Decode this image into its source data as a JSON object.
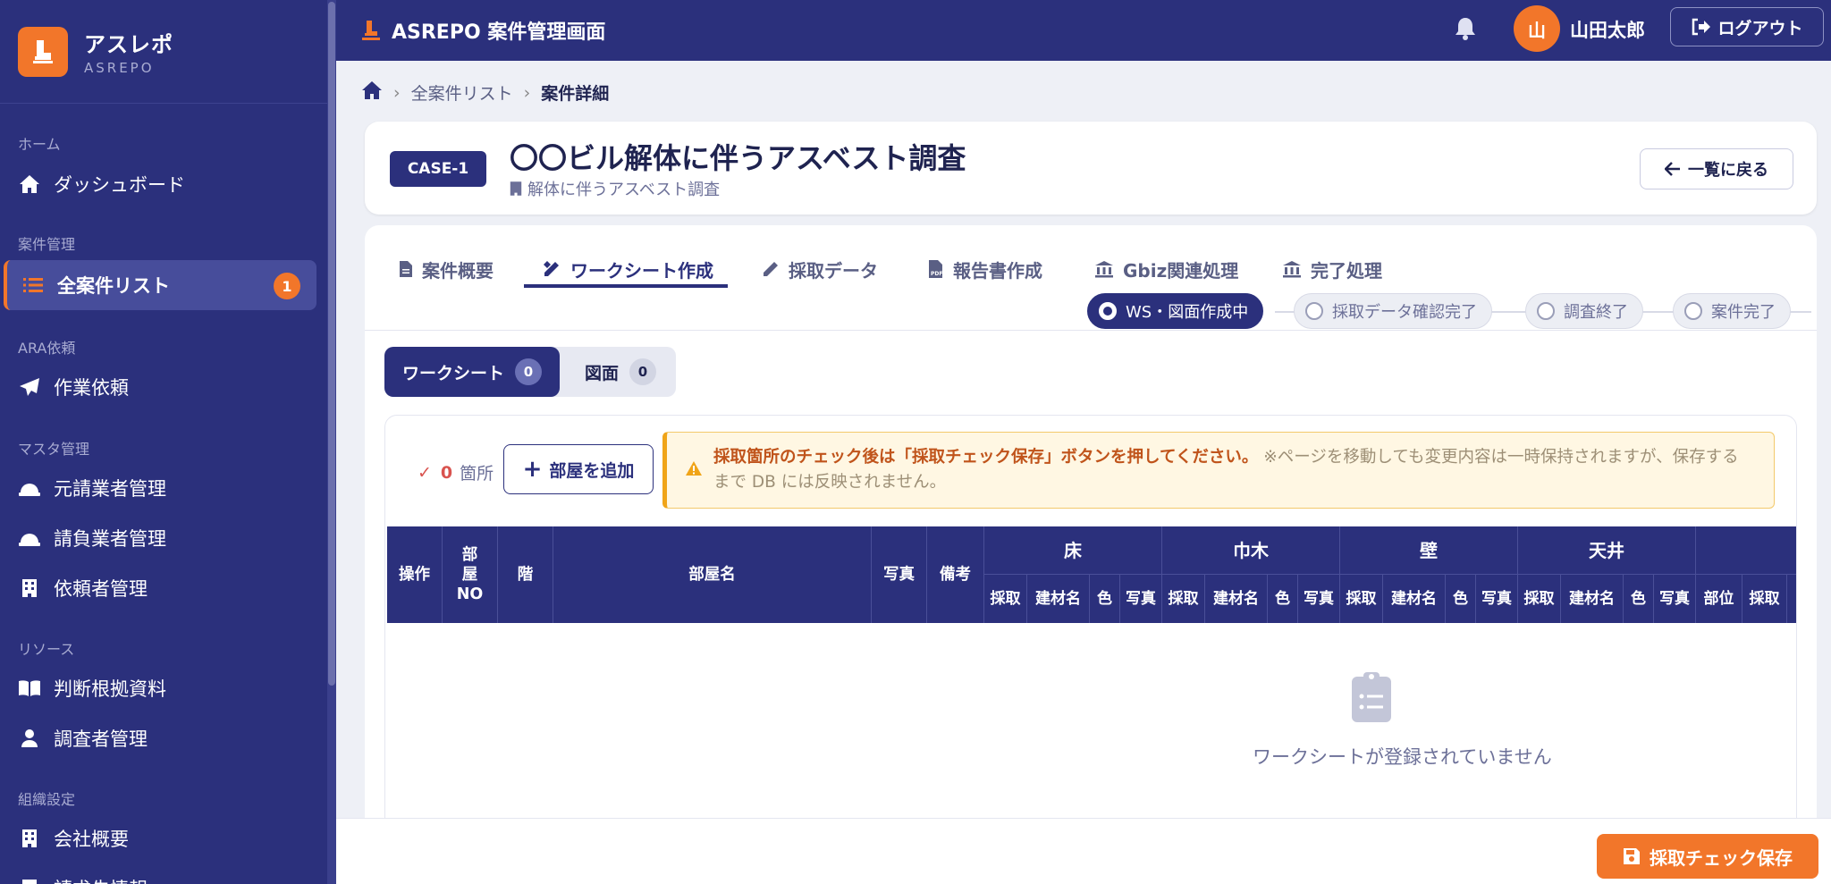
{
  "brand": {
    "name": "アスレポ",
    "sub": "ASREPO"
  },
  "sidebar": {
    "sections": [
      {
        "label": "ホーム",
        "items": [
          {
            "label": "ダッシュボード",
            "icon": "home-icon"
          }
        ]
      },
      {
        "label": "案件管理",
        "items": [
          {
            "label": "全案件リスト",
            "icon": "list-icon",
            "badge": "1",
            "active": true
          }
        ]
      },
      {
        "label": "ARA依頼",
        "items": [
          {
            "label": "作業依頼",
            "icon": "paper-plane-icon"
          }
        ]
      },
      {
        "label": "マスタ管理",
        "items": [
          {
            "label": "元請業者管理",
            "icon": "hard-hat-icon"
          },
          {
            "label": "請負業者管理",
            "icon": "hard-hat-icon"
          },
          {
            "label": "依頼者管理",
            "icon": "building-icon"
          }
        ]
      },
      {
        "label": "リソース",
        "items": [
          {
            "label": "判断根拠資料",
            "icon": "book-icon"
          },
          {
            "label": "調査者管理",
            "icon": "user-tie-icon"
          }
        ]
      },
      {
        "label": "組織設定",
        "items": [
          {
            "label": "会社概要",
            "icon": "building-icon"
          },
          {
            "label": "請求先情報",
            "icon": "building-icon"
          }
        ]
      }
    ]
  },
  "header": {
    "title": "ASREPO 案件管理画面",
    "user_initial": "山",
    "user_name": "山田太郎",
    "logout_label": "ログアウト"
  },
  "breadcrumb": {
    "level1": "全案件リスト",
    "current": "案件詳細"
  },
  "case": {
    "id": "CASE-1",
    "title": "〇〇ビル解体に伴うアスベスト調査",
    "subtitle": "解体に伴うアスベスト調査",
    "back_label": "一覧に戻る"
  },
  "tabs": [
    "案件概要",
    "ワークシート作成",
    "採取データ",
    "報告書作成",
    "Gbiz関連処理",
    "完了処理"
  ],
  "active_tab": "ワークシート作成",
  "statuses": [
    "WS・図面作成中",
    "採取データ確認完了",
    "調査終了",
    "案件完了"
  ],
  "active_status": "WS・図面作成中",
  "segments": {
    "worksheet_label": "ワークシート",
    "worksheet_count": "0",
    "drawing_label": "図面",
    "drawing_count": "0"
  },
  "toolbar": {
    "check": "✓",
    "count": "0",
    "count_unit": "箇所",
    "add_room_label": "部屋を追加"
  },
  "alert": {
    "strong": "採取箇所のチェック後は「採取チェック保存」ボタンを押してください。",
    "soft": "※ページを移動しても変更内容は一時保持されますが、保存するまで DB には反映されません。"
  },
  "table": {
    "columns": [
      "操作",
      "部屋NO",
      "階",
      "部屋名",
      "写真",
      "備考"
    ],
    "groups": [
      "床",
      "巾木",
      "壁",
      "天井"
    ],
    "sub4": [
      "採取",
      "建材名",
      "色",
      "写真"
    ],
    "tail": [
      "部位",
      "採取"
    ]
  },
  "empty_message": "ワークシートが登録されていません",
  "footer": {
    "save_label": "採取チェック保存"
  },
  "colors": {
    "primary": "#2b307c",
    "accent": "#f2762a"
  }
}
